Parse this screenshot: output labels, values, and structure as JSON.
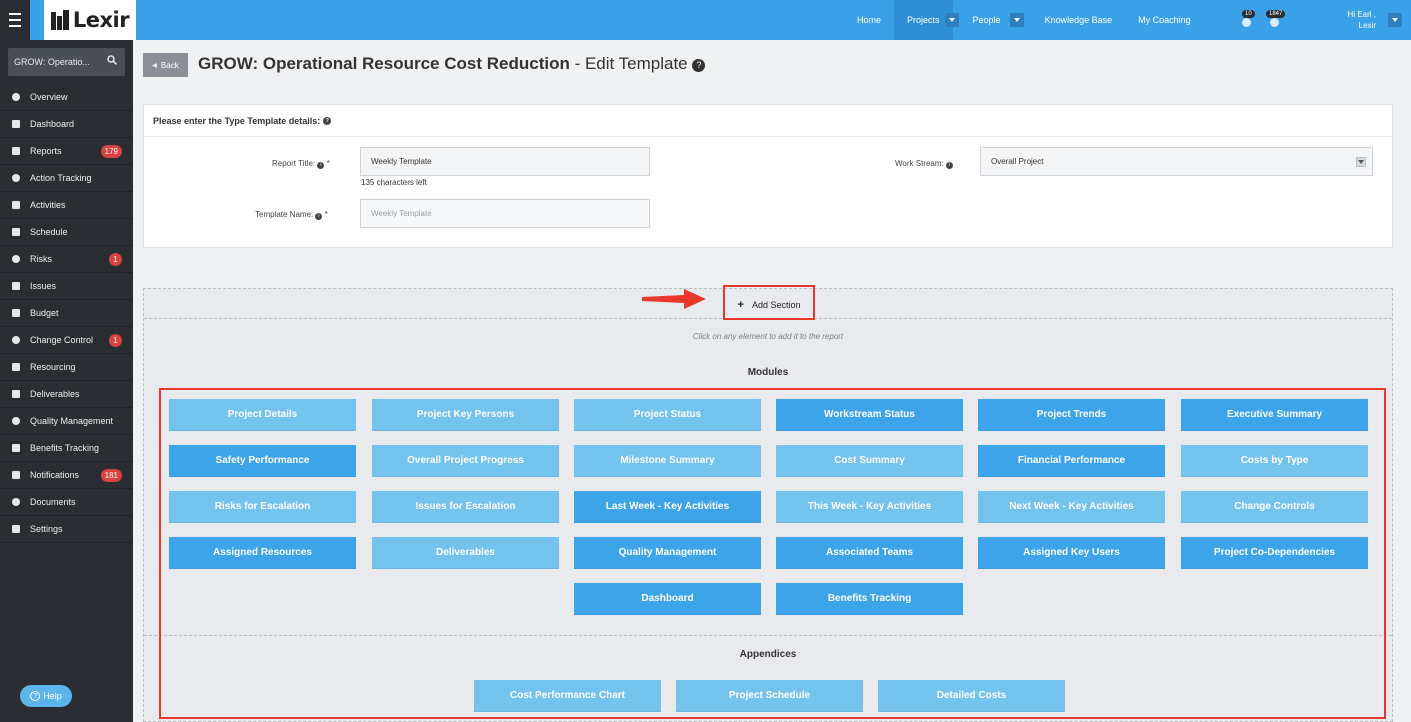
{
  "topbar": {
    "brand": "Lexir",
    "nav": [
      {
        "label": "Home",
        "active": false,
        "dropdown": false
      },
      {
        "label": "Projects",
        "active": true,
        "dropdown": true
      },
      {
        "label": "People",
        "active": false,
        "dropdown": true
      },
      {
        "label": "Knowledge Base",
        "active": false,
        "dropdown": false
      },
      {
        "label": "My Coaching",
        "active": false,
        "dropdown": false
      }
    ],
    "alerts_count": "10",
    "messages_count": "1847",
    "greeting_line1": "Hi Earl ,",
    "greeting_line2": "Lexir"
  },
  "sidebar": {
    "search_value": "GROW: Operatio...",
    "items": [
      {
        "label": "Overview",
        "icon": "overview-icon",
        "badge": ""
      },
      {
        "label": "Dashboard",
        "icon": "dashboard-icon",
        "badge": ""
      },
      {
        "label": "Reports",
        "icon": "reports-icon",
        "badge": "179"
      },
      {
        "label": "Action Tracking",
        "icon": "action-tracking-icon",
        "badge": ""
      },
      {
        "label": "Activities",
        "icon": "activities-icon",
        "badge": ""
      },
      {
        "label": "Schedule",
        "icon": "schedule-icon",
        "badge": ""
      },
      {
        "label": "Risks",
        "icon": "risks-icon",
        "badge": "1"
      },
      {
        "label": "Issues",
        "icon": "issues-icon",
        "badge": ""
      },
      {
        "label": "Budget",
        "icon": "budget-icon",
        "badge": ""
      },
      {
        "label": "Change Control",
        "icon": "change-control-icon",
        "badge": "1"
      },
      {
        "label": "Resourcing",
        "icon": "resourcing-icon",
        "badge": ""
      },
      {
        "label": "Deliverables",
        "icon": "deliverables-icon",
        "badge": ""
      },
      {
        "label": "Quality Management",
        "icon": "quality-management-icon",
        "badge": ""
      },
      {
        "label": "Benefits Tracking",
        "icon": "benefits-tracking-icon",
        "badge": ""
      },
      {
        "label": "Notifications",
        "icon": "notifications-icon",
        "badge": "181"
      },
      {
        "label": "Documents",
        "icon": "documents-icon",
        "badge": ""
      },
      {
        "label": "Settings",
        "icon": "settings-icon",
        "badge": ""
      }
    ],
    "help_label": "Help"
  },
  "header": {
    "back_label": "Back",
    "title_bold": "GROW: Operational Resource Cost Reduction",
    "title_rest": " - Edit Template"
  },
  "form": {
    "panel_title": "Please enter the Type Template details:",
    "report_title_label": "Report Title:",
    "report_title_value": "Weekly Template",
    "chars_left": "135 characters left",
    "template_name_label": "Template Name:",
    "template_name_placeholder": "Weekly Template",
    "work_stream_label": "Work Stream:",
    "work_stream_value": "Overall Project",
    "required_mark": "*"
  },
  "builder": {
    "add_section_label": "Add Section",
    "click_hint": "Click on any element to add it to the report",
    "modules_title": "Modules",
    "modules": [
      {
        "label": "Project Details",
        "tone": "light"
      },
      {
        "label": "Project Key Persons",
        "tone": "light"
      },
      {
        "label": "Project Status",
        "tone": "light"
      },
      {
        "label": "Workstream Status",
        "tone": "dark"
      },
      {
        "label": "Project Trends",
        "tone": "dark"
      },
      {
        "label": "Executive Summary",
        "tone": "dark"
      },
      {
        "label": "Safety Performance",
        "tone": "dark"
      },
      {
        "label": "Overall Project Progress",
        "tone": "light"
      },
      {
        "label": "Milestone Summary",
        "tone": "light"
      },
      {
        "label": "Cost Summary",
        "tone": "light"
      },
      {
        "label": "Financial Performance",
        "tone": "dark"
      },
      {
        "label": "Costs by Type",
        "tone": "light"
      },
      {
        "label": "Risks for Escalation",
        "tone": "light"
      },
      {
        "label": "Issues for Escalation",
        "tone": "light"
      },
      {
        "label": "Last Week - Key Activities",
        "tone": "dark"
      },
      {
        "label": "This Week - Key Activities",
        "tone": "light"
      },
      {
        "label": "Next Week - Key Activities",
        "tone": "light"
      },
      {
        "label": "Change Controls",
        "tone": "light"
      },
      {
        "label": "Assigned Resources",
        "tone": "dark"
      },
      {
        "label": "Deliverables",
        "tone": "light"
      },
      {
        "label": "Quality Management",
        "tone": "dark"
      },
      {
        "label": "Associated Teams",
        "tone": "dark"
      },
      {
        "label": "Assigned Key Users",
        "tone": "dark"
      },
      {
        "label": "Project Co-Dependencies",
        "tone": "dark"
      },
      {
        "label": "Dashboard",
        "tone": "dark"
      },
      {
        "label": "Benefits Tracking",
        "tone": "dark"
      }
    ],
    "appendices_title": "Appendices",
    "appendices": [
      {
        "label": "Cost Performance Chart",
        "tone": "light"
      },
      {
        "label": "Project Schedule",
        "tone": "light"
      },
      {
        "label": "Detailed Costs",
        "tone": "light"
      }
    ]
  },
  "colors": {
    "topbar": "#3aa0e8",
    "sidebar": "#2a2e33",
    "module_light": "#74c3ee",
    "module_dark": "#3da4ea",
    "annotation_red": "#e8382b",
    "badge_red": "#d9433f"
  }
}
